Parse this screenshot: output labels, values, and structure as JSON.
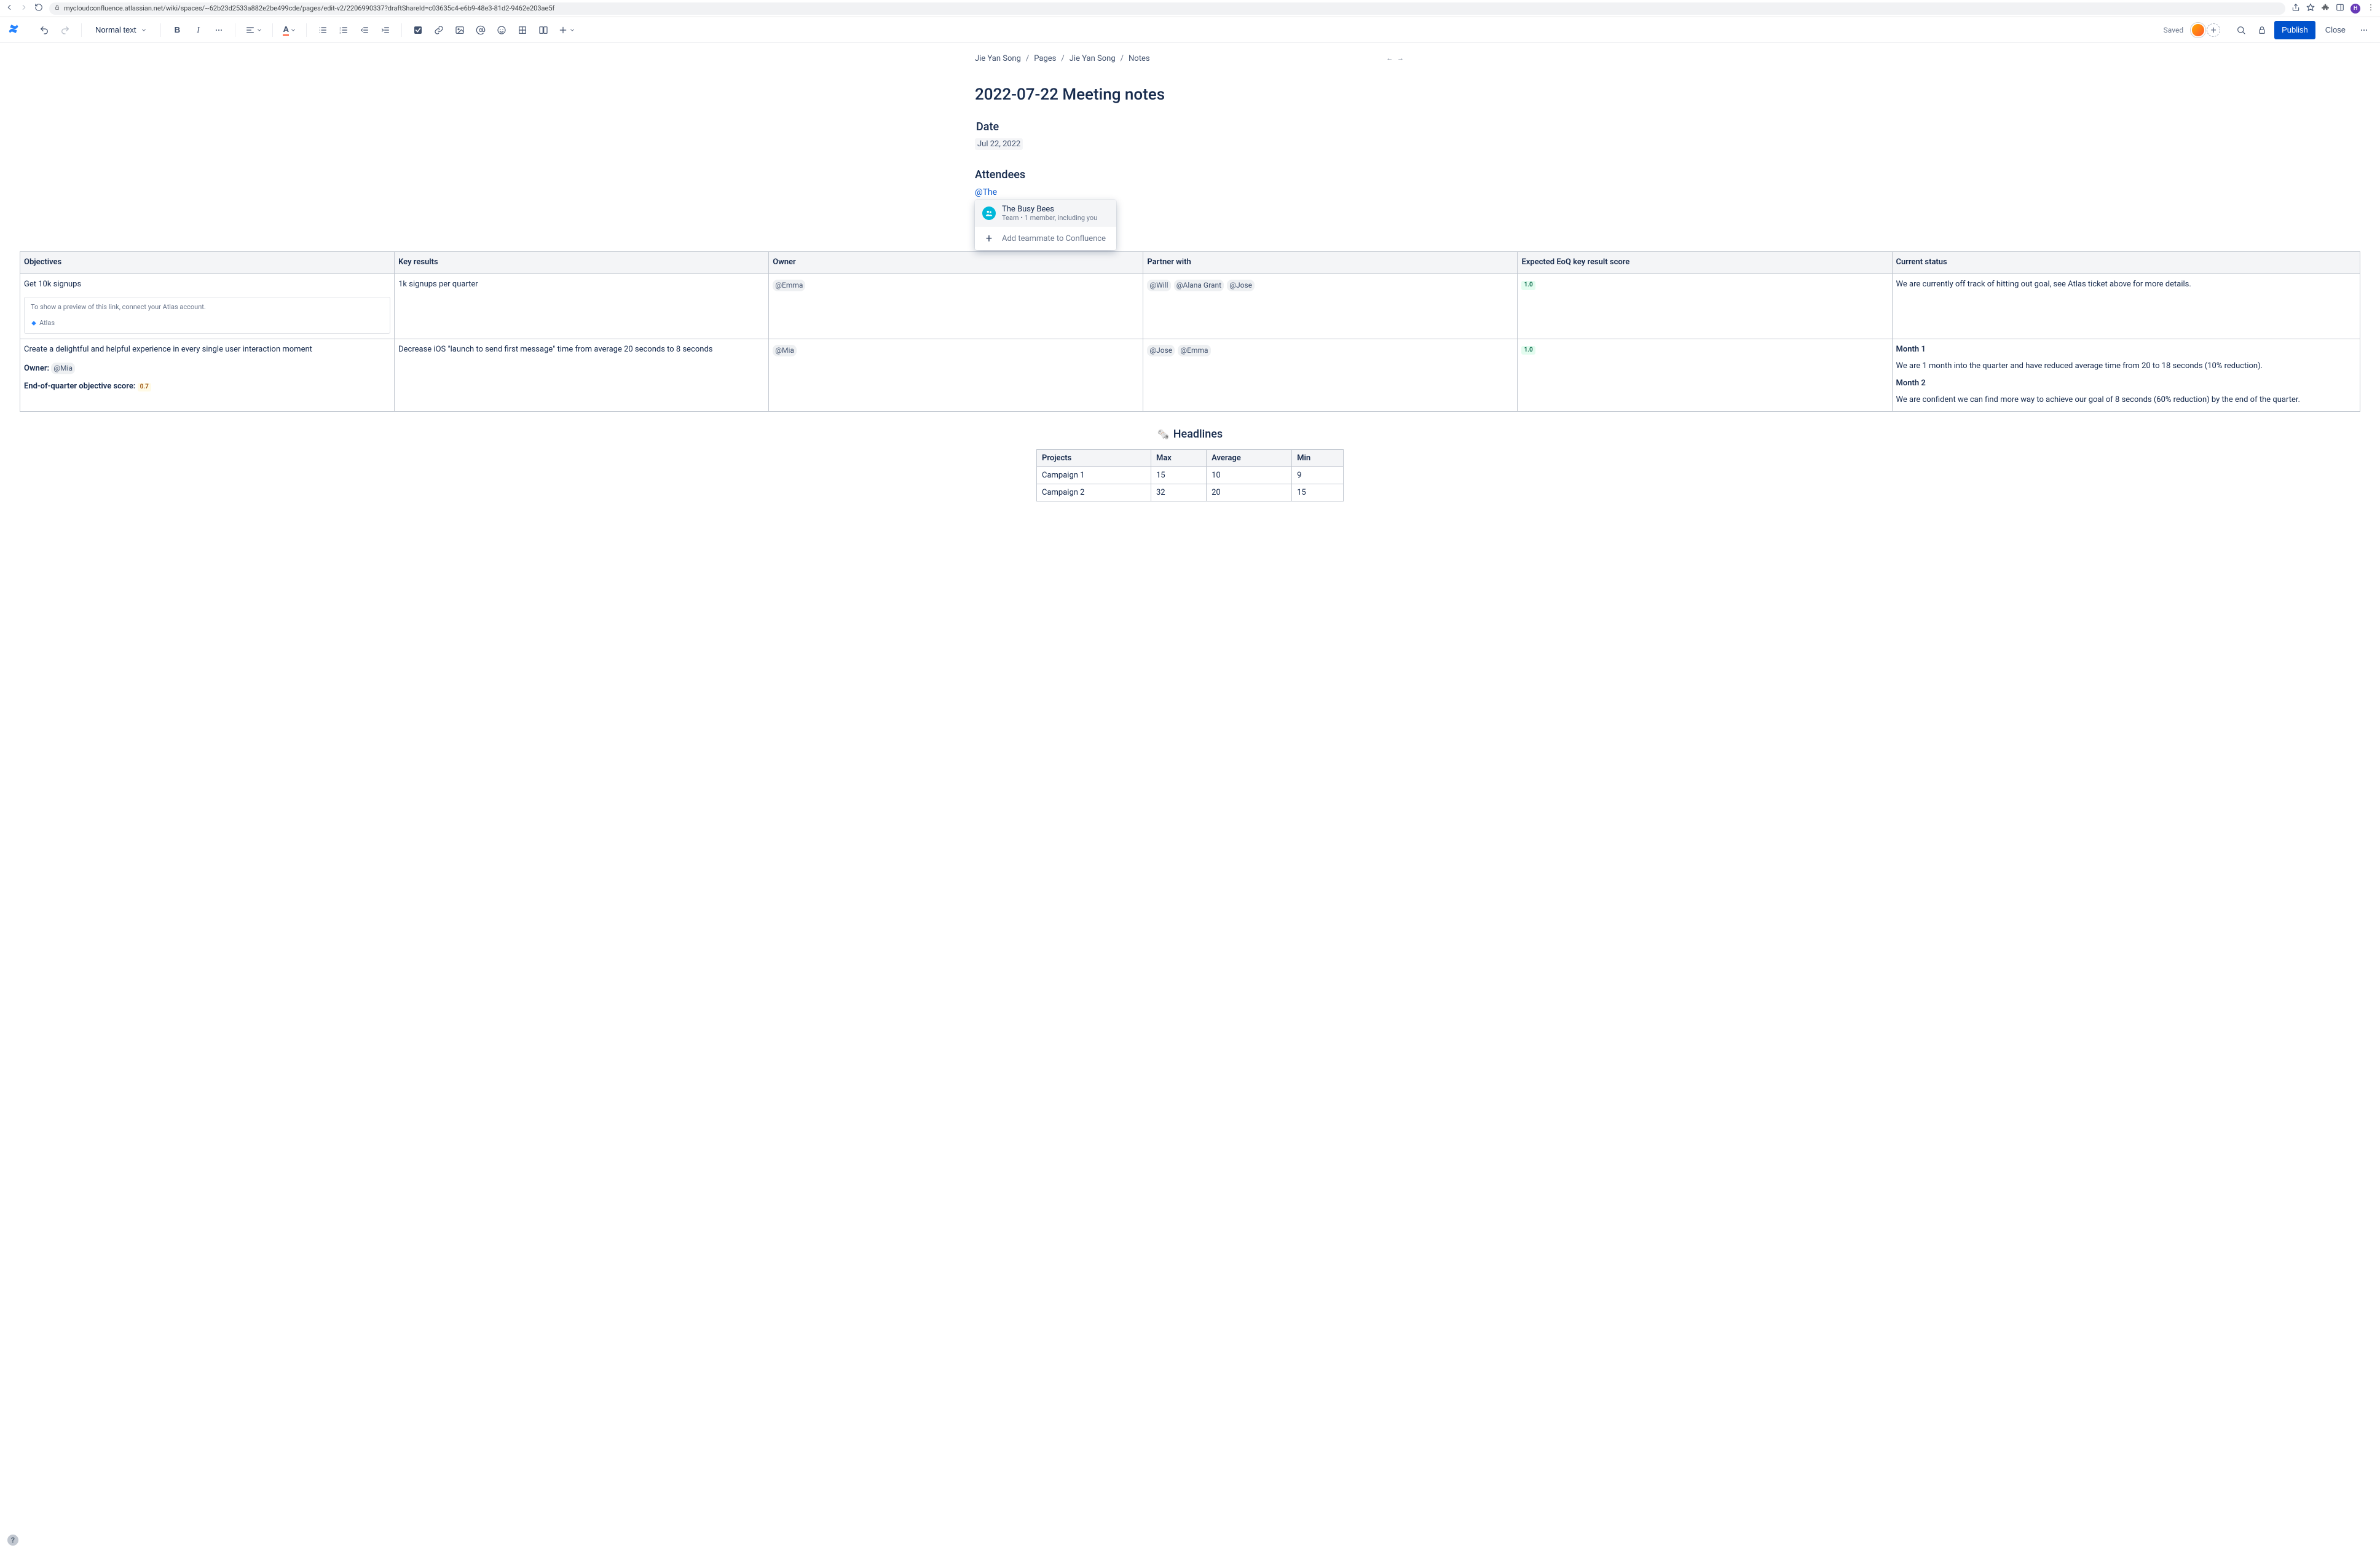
{
  "browser": {
    "url": "mycloudconfluence.atlassian.net/wiki/spaces/~62b23d2533a882e2be499cde/pages/edit-v2/2206990337?draftShareId=c03635c4-e6b9-48e3-81d2-9462e203ae5f",
    "profile_initial": "H"
  },
  "toolbar": {
    "text_style": "Normal text",
    "saved_label": "Saved",
    "publish_label": "Publish",
    "close_label": "Close"
  },
  "breadcrumbs": [
    "Jie Yan Song",
    "Pages",
    "Jie Yan Song",
    "Notes"
  ],
  "page": {
    "title": "2022-07-22 Meeting notes",
    "date_heading": "Date",
    "date_value": "Jul 22, 2022",
    "attendees_heading": "Attendees",
    "mention_query": "@The"
  },
  "mention_popup": {
    "item_title": "The Busy Bees",
    "item_sub": "Team • 1 member, including you",
    "add_label": "Add teammate to Confluence"
  },
  "okr_table": {
    "headers": [
      "Objectives",
      "Key results",
      "Owner",
      "Partner with",
      "Expected EoQ key result score",
      "Current status"
    ],
    "rows": [
      {
        "objective": "Get 10k signups",
        "atlas_msg": "To show a preview of this link, connect your Atlas account.",
        "atlas_name": "Atlas",
        "key_result": "1k signups per quarter",
        "owner": [
          "@Emma"
        ],
        "partners": [
          "@Will",
          "@Alana Grant",
          "@Jose"
        ],
        "score": "1.0",
        "status_paras": [
          "We are currently off track of hitting out goal, see Atlas ticket above for more details."
        ]
      },
      {
        "objective": "Create a delightful and helpful experience in every single user interaction moment",
        "owner_label": "Owner:",
        "owner_inline": "@Mia",
        "eoq_label": "End-of-quarter objective score:",
        "eoq_score": "0.7",
        "key_result": "Decrease iOS \"launch to send first message\" time from average 20 seconds to 8 seconds",
        "owner": [
          "@Mia"
        ],
        "partners": [
          "@Jose",
          "@Emma"
        ],
        "score": "1.0",
        "status_blocks": [
          {
            "h": "Month 1",
            "p": "We are 1 month into the quarter and have reduced average time from 20 to 18 seconds (10% reduction)."
          },
          {
            "h": "Month 2",
            "p": "We are confident we can find more way to achieve our goal of 8 seconds (60% reduction) by the end of the quarter."
          }
        ]
      }
    ]
  },
  "headlines": {
    "heading": "Headlines",
    "headers": [
      "Projects",
      "Max",
      "Average",
      "Min"
    ],
    "rows": [
      {
        "project": "Campaign 1",
        "max": "15",
        "avg": "10",
        "min": "9"
      },
      {
        "project": "Campaign 2",
        "max": "32",
        "avg": "20",
        "min": "15"
      }
    ]
  },
  "chart_data": {
    "type": "table",
    "title": "Headlines",
    "columns": [
      "Projects",
      "Max",
      "Average",
      "Min"
    ],
    "rows": [
      [
        "Campaign 1",
        15,
        10,
        9
      ],
      [
        "Campaign 2",
        32,
        20,
        15
      ]
    ]
  }
}
